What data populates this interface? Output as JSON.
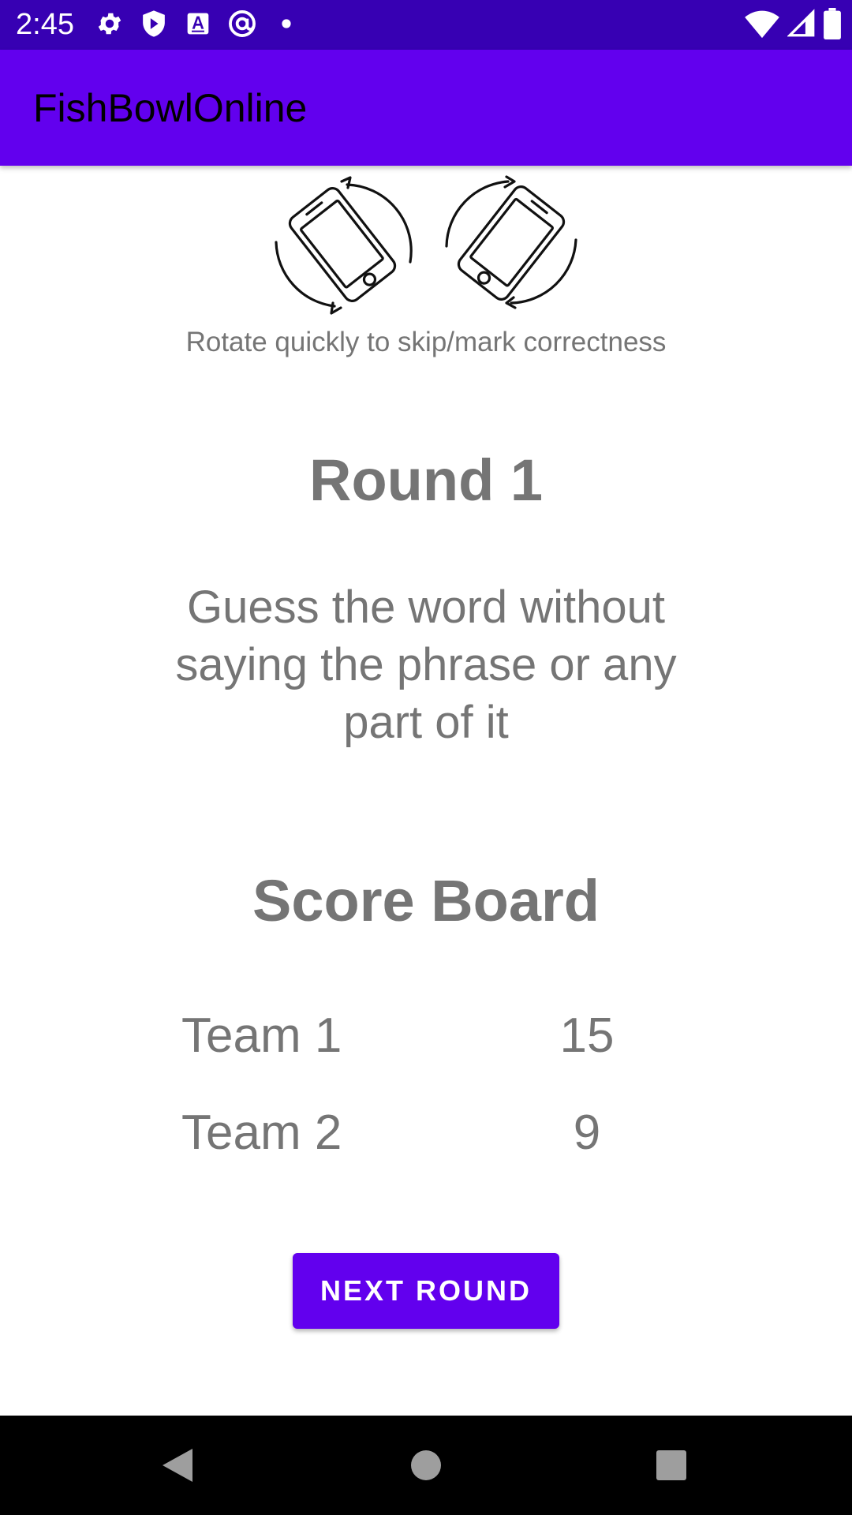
{
  "status_bar": {
    "time": "2:45",
    "left_icons": [
      "settings-icon",
      "shield-icon",
      "font-icon",
      "at-sign-icon",
      "dot-icon"
    ],
    "right_icons": [
      "wifi-icon",
      "signal-icon",
      "battery-icon"
    ]
  },
  "app_bar": {
    "title": "FishBowlOnline"
  },
  "rotate": {
    "icons": [
      "phone-rotate-clockwise-icon",
      "phone-rotate-counterclockwise-icon"
    ],
    "hint": "Rotate quickly to skip/mark correctness"
  },
  "round": {
    "title": "Round 1",
    "description": "Guess the word without saying the phrase or any part of it"
  },
  "scoreboard": {
    "title": "Score Board",
    "rows": [
      {
        "team": "Team 1",
        "score": "15"
      },
      {
        "team": "Team 2",
        "score": "9"
      }
    ]
  },
  "actions": {
    "next_round_label": "NEXT ROUND"
  },
  "nav_bar": {
    "icons": [
      "back-icon",
      "home-icon",
      "recents-icon"
    ]
  },
  "colors": {
    "status_bar": "#3700b3",
    "primary": "#6200ee",
    "text_gray": "#757575"
  }
}
